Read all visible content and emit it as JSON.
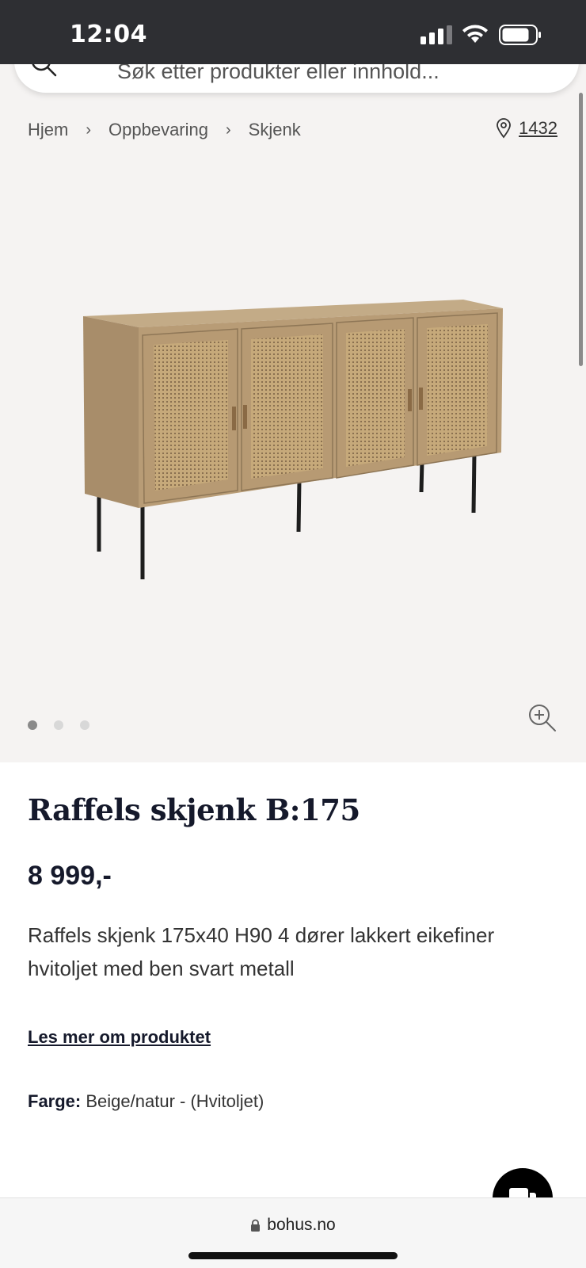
{
  "status": {
    "time": "12:04"
  },
  "search": {
    "placeholder": "Søk etter produkter eller innhold..."
  },
  "breadcrumb": [
    "Hjem",
    "Oppbevaring",
    "Skjenk"
  ],
  "store": {
    "postal_code": "1432"
  },
  "gallery": {
    "image_count": 3,
    "active_index": 0
  },
  "product": {
    "title": "Raffels skjenk B:175",
    "price": "8 999,-",
    "description": "Raffels skjenk 175x40 H90 4 dører lakkert eikefiner hvitoljet med ben svart metall",
    "read_more": "Les mer om produktet",
    "color_label": "Farge:",
    "color_value": "Beige/natur - (Hvitoljet)"
  },
  "browser": {
    "url": "bohus.no"
  },
  "colors": {
    "dark_navy": "#15192b",
    "status_bar": "#2e2f33",
    "image_bg": "#f5f3f2"
  }
}
